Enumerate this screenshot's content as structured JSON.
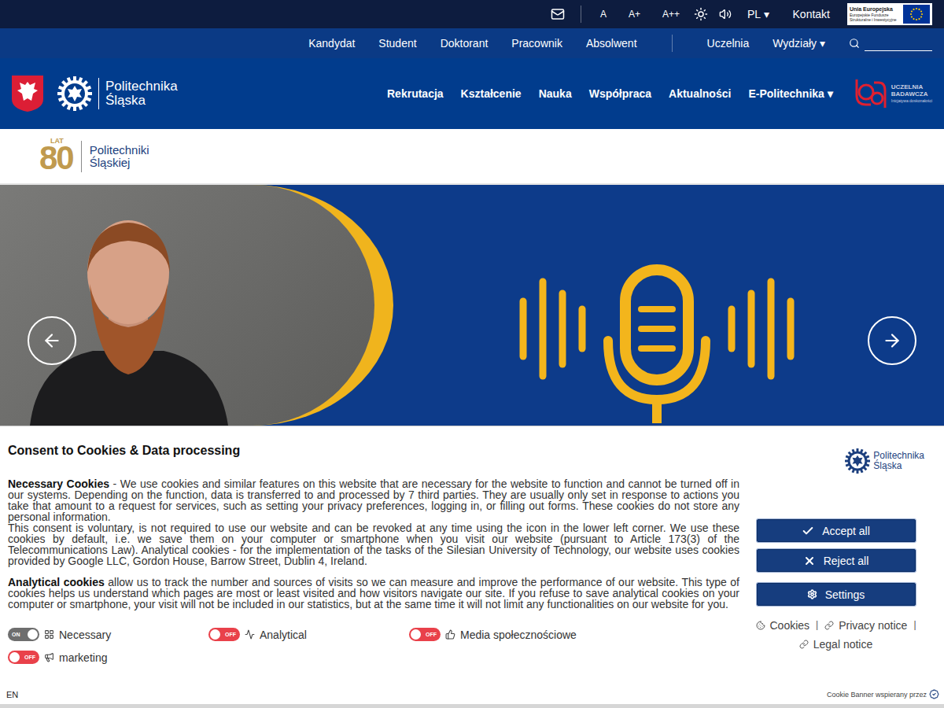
{
  "top_bar": {
    "font_sizes": [
      "A",
      "A+",
      "A++"
    ],
    "language": "PL ▾",
    "contact": "Kontakt",
    "eu_logo": {
      "title": "Unia Europejska",
      "subtitle": "Europejskie Fundusze Strukturalne i Inwestycyjne"
    }
  },
  "audience_nav": {
    "items": [
      "Kandydat",
      "Student",
      "Doktorant",
      "Pracownik",
      "Absolwent"
    ],
    "secondary": [
      "Uczelnia",
      "Wydziały ▾"
    ]
  },
  "header": {
    "logo": {
      "line1": "Politechnika",
      "line2": "Śląska"
    },
    "nav": [
      "Rekrutacja",
      "Kształcenie",
      "Nauka",
      "Współpraca",
      "Aktualności",
      "E-Politechnika ▾"
    ],
    "badge": {
      "line1": "UCZELNIA",
      "line2": "BADAWCZA",
      "line3": "Inicjatywa doskonałości"
    }
  },
  "anniversary": {
    "number": "80",
    "label": "LAT",
    "line1": "Politechniki",
    "line2": "Śląskiej"
  },
  "cookie_banner": {
    "title": "Consent to Cookies & Data processing",
    "paragraphs": [
      {
        "lead": "Necessary Cookies",
        "lines": [
          " - We use cookies and similar features on this website that are necessary for the website to function and cannot be turned off in our systems. Depending on the function, data is transferred to and processed by 7 third parties. They are usually only set in response to actions you take that amount to a request for services, such as setting your privacy preferences, logging in, or filling out forms. These cookies do not store any personal information.",
          "This consent is voluntary, is not required to use our website and can be revoked at any time using the icon in the lower left corner. We use these cookies by default, i.e. we save them on your computer or smartphone when you visit our website (pursuant to Article 173(3) of the Telecommunications Law). Analytical cookies - for the implementation of the tasks of the Silesian University of Technology, our website uses cookies provided by Google LLC, Gordon House, Barrow Street, Dublin 4, Ireland."
        ]
      },
      {
        "lead": "Analytical cookies",
        "lines": [
          " allow us to track the number and sources of visits so we can measure and improve the performance of our website. This type of cookies helps us understand which pages are most or least visited and how visitors navigate our site. If you refuse to save analytical cookies on your computer or smartphone, your visit will not be included in our statistics, but at the same time it will not limit any functionalities on our website for you."
        ]
      }
    ],
    "toggles": [
      {
        "label": "Necessary",
        "on": true,
        "disabled": true,
        "state": "ON"
      },
      {
        "label": "Analytical",
        "on": false,
        "disabled": false,
        "state": "OFF"
      },
      {
        "label": "Media społecznościowe",
        "on": false,
        "disabled": false,
        "state": "OFF"
      },
      {
        "label": "marketing",
        "on": false,
        "disabled": false,
        "state": "OFF"
      }
    ],
    "logo": {
      "line1": "Politechnika",
      "line2": "Śląska"
    },
    "buttons": [
      "Accept all",
      "Reject all",
      "Settings"
    ],
    "links": [
      "Cookies",
      "Privacy notice",
      "Legal notice"
    ],
    "separator": "|",
    "language": "EN",
    "powered_by": "Cookie Banner wspierany przez"
  }
}
